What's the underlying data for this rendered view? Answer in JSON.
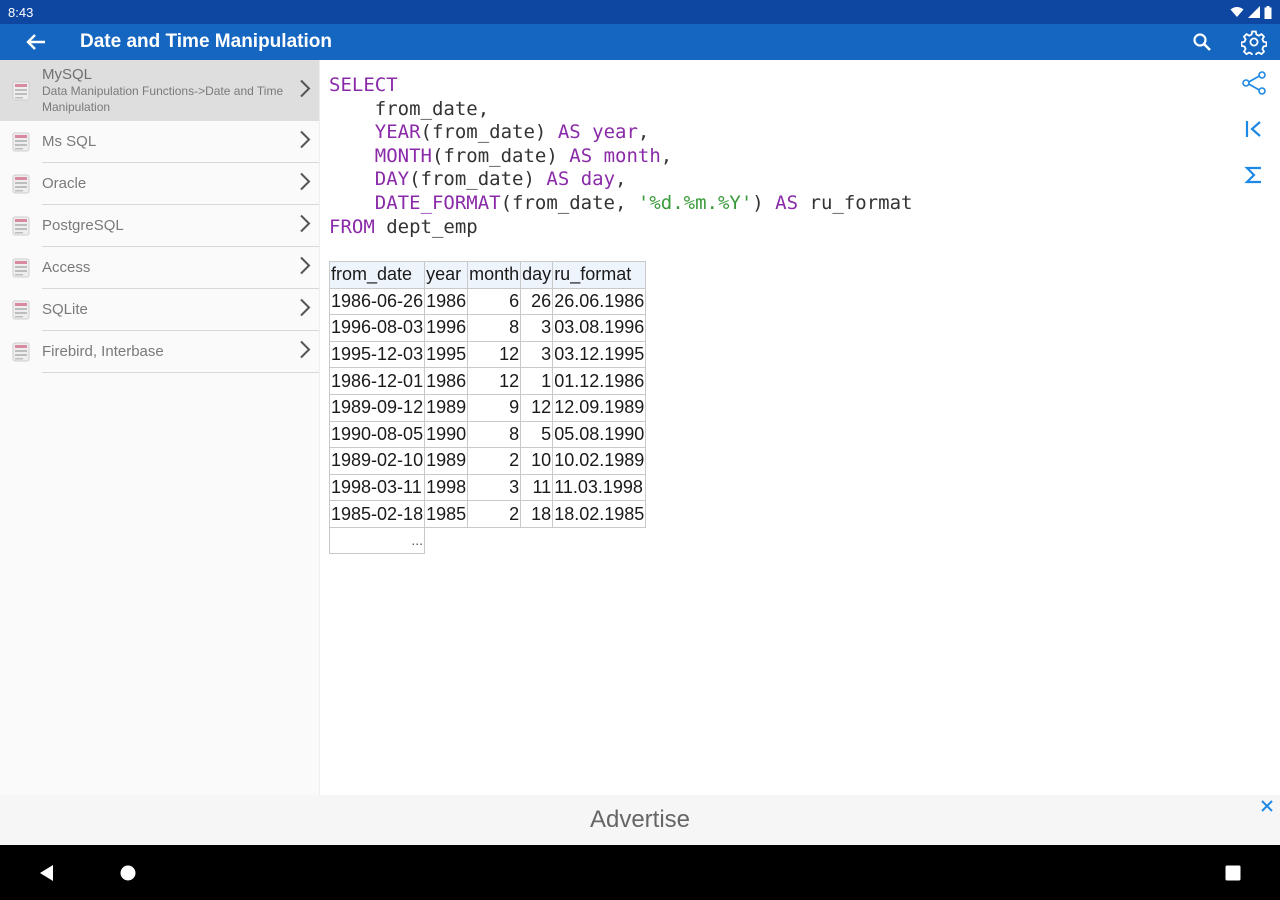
{
  "status": {
    "time": "8:43"
  },
  "appbar": {
    "title": "Date and Time Manipulation"
  },
  "sidebar": {
    "items": [
      {
        "label": "MySQL",
        "sub": "Data Manipulation Functions->Date and Time Manipulation",
        "selected": true
      },
      {
        "label": "Ms SQL"
      },
      {
        "label": "Oracle"
      },
      {
        "label": "PostgreSQL"
      },
      {
        "label": "Access"
      },
      {
        "label": "SQLite"
      },
      {
        "label": "Firebird, Interbase"
      }
    ]
  },
  "code": {
    "lines": [
      [
        {
          "t": "SELECT",
          "c": "kw"
        }
      ],
      [
        {
          "t": "    from_date,"
        }
      ],
      [
        {
          "t": "    "
        },
        {
          "t": "YEAR",
          "c": "kw"
        },
        {
          "t": "(from_date) "
        },
        {
          "t": "AS",
          "c": "kw"
        },
        {
          "t": " "
        },
        {
          "t": "year",
          "c": "kw"
        },
        {
          "t": ","
        }
      ],
      [
        {
          "t": "    "
        },
        {
          "t": "MONTH",
          "c": "kw"
        },
        {
          "t": "(from_date) "
        },
        {
          "t": "AS",
          "c": "kw"
        },
        {
          "t": " "
        },
        {
          "t": "month",
          "c": "kw"
        },
        {
          "t": ","
        }
      ],
      [
        {
          "t": "    "
        },
        {
          "t": "DAY",
          "c": "kw"
        },
        {
          "t": "(from_date) "
        },
        {
          "t": "AS",
          "c": "kw"
        },
        {
          "t": " "
        },
        {
          "t": "day",
          "c": "kw"
        },
        {
          "t": ","
        }
      ],
      [
        {
          "t": "    "
        },
        {
          "t": "DATE_FORMAT",
          "c": "kw"
        },
        {
          "t": "(from_date, "
        },
        {
          "t": "'%d.%m.%Y'",
          "c": "str"
        },
        {
          "t": ") "
        },
        {
          "t": "AS",
          "c": "kw"
        },
        {
          "t": " ru_format"
        }
      ],
      [
        {
          "t": "FROM",
          "c": "kw"
        },
        {
          "t": " dept_emp"
        }
      ]
    ]
  },
  "table": {
    "headers": [
      "from_date",
      "year",
      "month",
      "day",
      "ru_format"
    ],
    "rows": [
      [
        "1986-06-26",
        "1986",
        "6",
        "26",
        "26.06.1986"
      ],
      [
        "1996-08-03",
        "1996",
        "8",
        "3",
        "03.08.1996"
      ],
      [
        "1995-12-03",
        "1995",
        "12",
        "3",
        "03.12.1995"
      ],
      [
        "1986-12-01",
        "1986",
        "12",
        "1",
        "01.12.1986"
      ],
      [
        "1989-09-12",
        "1989",
        "9",
        "12",
        "12.09.1989"
      ],
      [
        "1990-08-05",
        "1990",
        "8",
        "5",
        "05.08.1990"
      ],
      [
        "1989-02-10",
        "1989",
        "2",
        "10",
        "10.02.1989"
      ],
      [
        "1998-03-11",
        "1998",
        "3",
        "11",
        "11.03.1998"
      ],
      [
        "1985-02-18",
        "1985",
        "2",
        "18",
        "18.02.1985"
      ]
    ],
    "more": "..."
  },
  "ad": {
    "text": "Advertise"
  },
  "colors": {
    "statusbar": "#0e47a1",
    "appbar": "#1566c0",
    "keyword": "#8a2aa8",
    "string": "#3a9a3a",
    "accent_icon": "#1e88e5"
  },
  "icons": {
    "appbar": [
      "back-arrow-icon",
      "search-icon",
      "settings-gear-icon"
    ],
    "rail": [
      "share-icon",
      "first-page-icon",
      "sigma-icon"
    ],
    "nav": [
      "nav-back-icon",
      "nav-home-icon",
      "nav-recents-icon"
    ]
  }
}
